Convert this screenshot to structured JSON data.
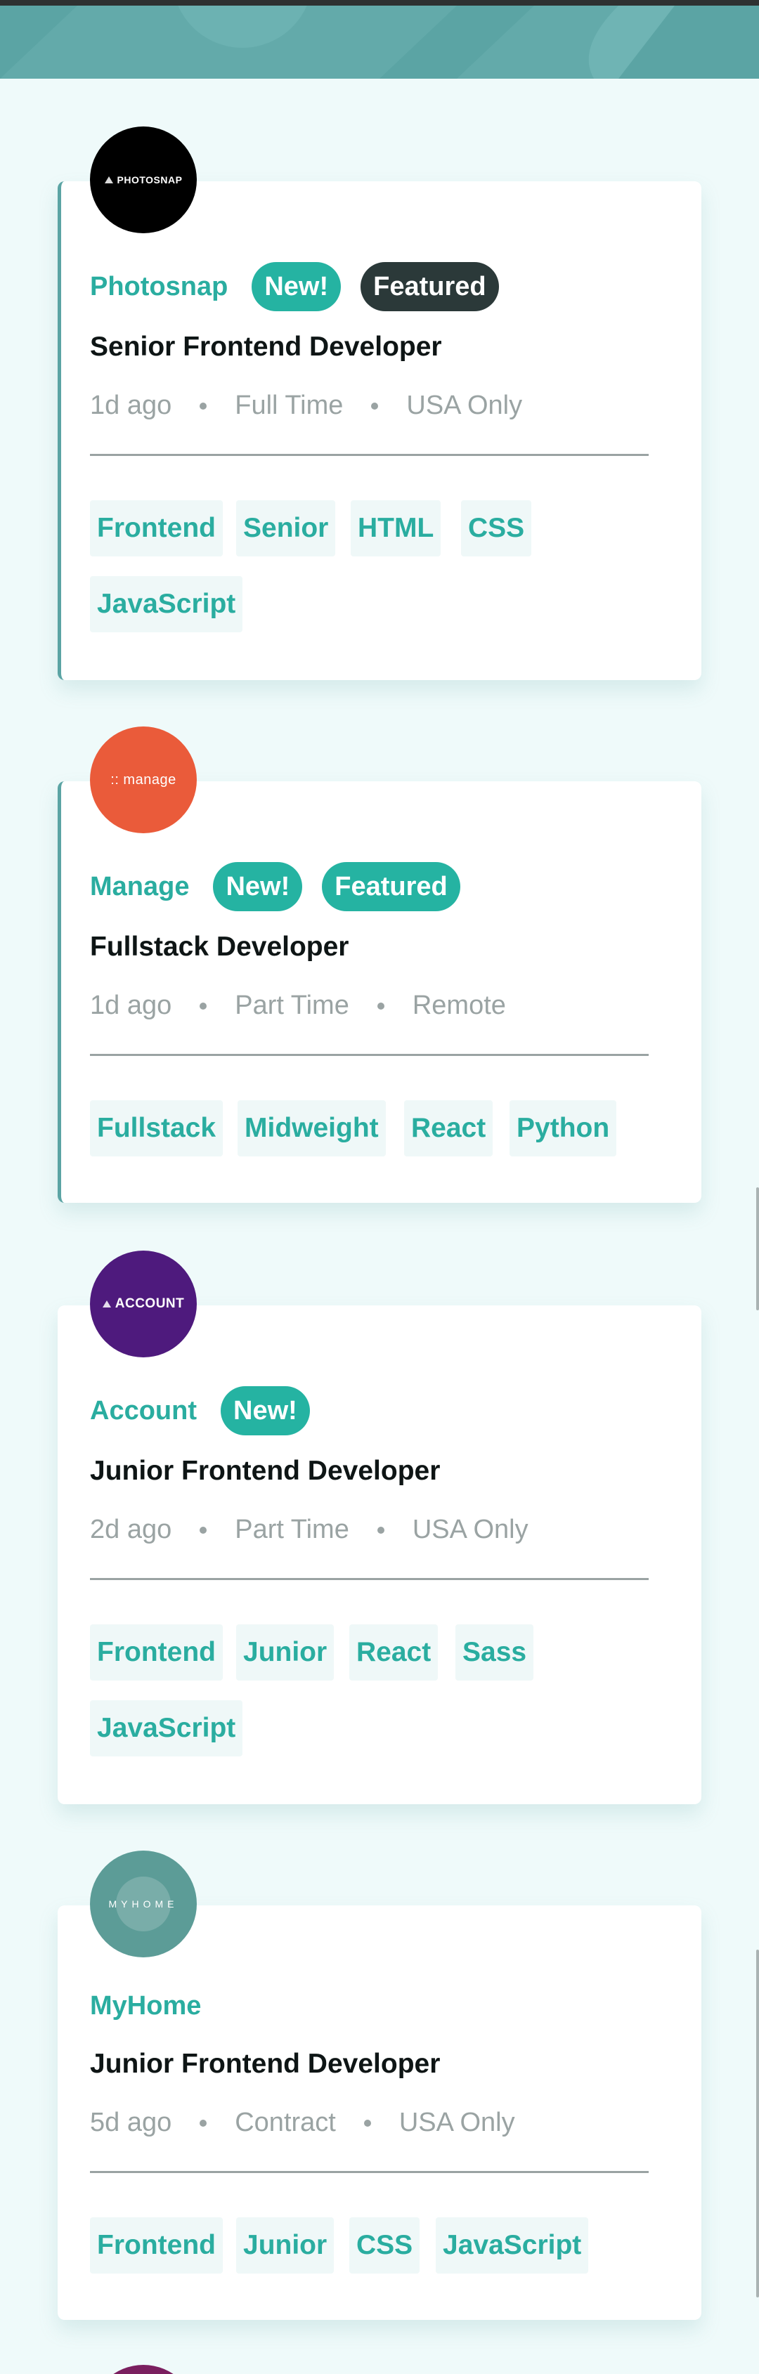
{
  "colors": {
    "header_bg": "#5ba4a4",
    "page_bg": "#effafa",
    "accent": "#25b3a2",
    "tag_bg": "#eff8f8"
  },
  "jobs": [
    {
      "company": "Photosnap",
      "logo_text": "PHOTOSNAP",
      "logo_color": "#000000",
      "new_label": "New!",
      "featured_label": "Featured",
      "position": "Senior Frontend Developer",
      "posted": "1d ago",
      "contract": "Full Time",
      "location": "USA Only",
      "tags": [
        "Frontend",
        "Senior",
        "HTML",
        "CSS",
        "JavaScript"
      ]
    },
    {
      "company": "Manage",
      "logo_text": ":: manage",
      "logo_color": "#ea5b3a",
      "new_label": "New!",
      "featured_label": "Featured",
      "position": "Fullstack Developer",
      "posted": "1d ago",
      "contract": "Part Time",
      "location": "Remote",
      "tags": [
        "Fullstack",
        "Midweight",
        "React",
        "Python"
      ]
    },
    {
      "company": "Account",
      "logo_text": "ACCOUNT",
      "logo_color": "#4e1a7d",
      "new_label": "New!",
      "position": "Junior Frontend Developer",
      "posted": "2d ago",
      "contract": "Part Time",
      "location": "USA Only",
      "tags": [
        "Frontend",
        "Junior",
        "React",
        "Sass",
        "JavaScript"
      ]
    },
    {
      "company": "MyHome",
      "logo_text": "MYHOME",
      "logo_color": "#5c9c97",
      "position": "Junior Frontend Developer",
      "posted": "5d ago",
      "contract": "Contract",
      "location": "USA Only",
      "tags": [
        "Frontend",
        "Junior",
        "CSS",
        "JavaScript"
      ]
    }
  ]
}
